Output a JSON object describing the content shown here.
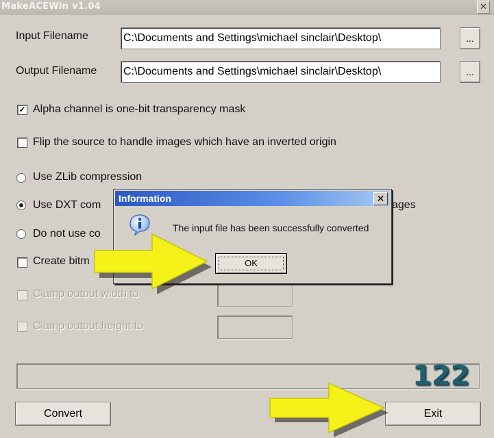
{
  "window": {
    "title": "MakeACEWin v1.04",
    "close_glyph": "✕"
  },
  "input": {
    "label": "Input Filename",
    "value": "C:\\Documents and Settings\\michael sinclair\\Desktop\\",
    "browse_label": "..."
  },
  "output": {
    "label": "Output Filename",
    "value": "C:\\Documents and Settings\\michael sinclair\\Desktop\\",
    "browse_label": "..."
  },
  "options": {
    "alpha_mask": {
      "label": "Alpha channel is one-bit transparency mask",
      "checked": true
    },
    "flip_source": {
      "label": "Flip the source to handle images which have an inverted origin",
      "checked": false
    }
  },
  "compression": {
    "zlib": {
      "label": "Use ZLib compression",
      "selected": false
    },
    "dxt": {
      "label": "Use DXT com",
      "suffix": "ages",
      "selected": true
    },
    "none": {
      "label": "Do not use co",
      "selected": false
    }
  },
  "create_bitmap": {
    "label": "Create bitm",
    "checked": false
  },
  "clamp_width": {
    "label": "Clamp output width to",
    "enabled": false,
    "value": ""
  },
  "clamp_height": {
    "label": "Clamp output height to",
    "enabled": false,
    "value": ""
  },
  "progress": {
    "value": 0
  },
  "badge": "122",
  "buttons": {
    "convert": "Convert",
    "exit": "Exit"
  },
  "dialog": {
    "title": "Information",
    "message": "The input file has been successfully converted",
    "ok_label": "OK",
    "close_glyph": "✕",
    "icon": "info-icon"
  },
  "annotations": {
    "arrow_color": "#f5f21a",
    "icons": [
      "yellow-arrow-right",
      "yellow-arrow-right"
    ]
  }
}
